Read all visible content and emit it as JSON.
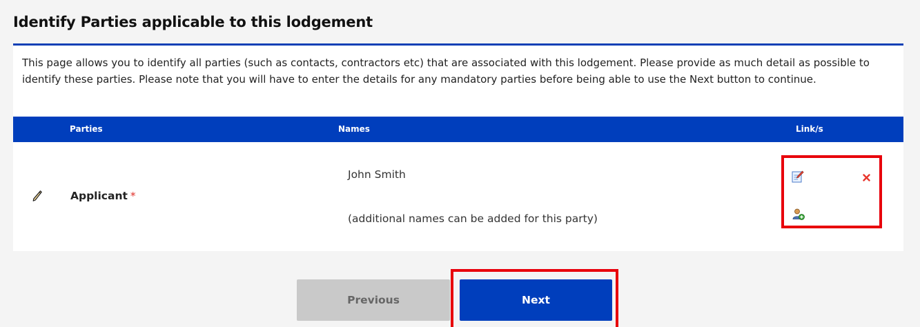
{
  "page": {
    "heading": "Identify Parties applicable to this lodgement",
    "intro": "This page allows you to identify all parties (such as contacts, contractors etc) that are associated with this lodgement. Please provide as much detail as possible to identify these parties. Please note that you will have to enter the details for any mandatory parties before being able to use the Next button to continue."
  },
  "table": {
    "headers": {
      "parties": "Parties",
      "names": "Names",
      "links": "Link/s"
    },
    "rows": [
      {
        "party": "Applicant",
        "required_mark": "*",
        "names": [
          "John Smith"
        ],
        "hint": "(additional names can be added for this party)",
        "icons": [
          "pencil-icon",
          "edit-record-icon",
          "delete-icon",
          "add-person-icon"
        ]
      }
    ]
  },
  "nav": {
    "previous_label": "Previous",
    "next_label": "Next"
  },
  "colors": {
    "accent": "#003ebc",
    "heading_rule": "#0a3fb5",
    "highlight": "#e8000b",
    "required": "#e0302a",
    "disabled_button": "#c9c9c9"
  }
}
